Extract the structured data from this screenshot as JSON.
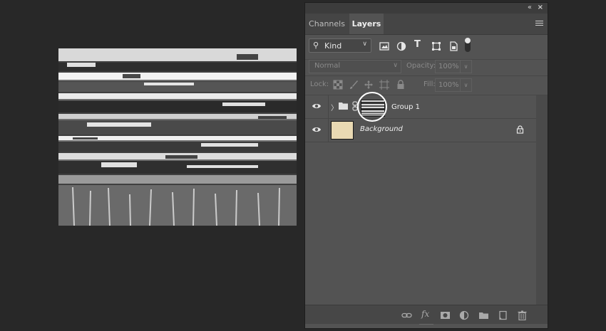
{
  "panel": {
    "tabs": [
      "Channels",
      "Layers"
    ],
    "active_tab": "Layers",
    "collapse_glyph": "«",
    "close_glyph": "×"
  },
  "filter": {
    "kind_label": "Kind",
    "icons": [
      "pixel-filter-icon",
      "adjustment-filter-icon",
      "type-filter-icon",
      "shape-filter-icon",
      "smart-object-filter-icon"
    ]
  },
  "blend": {
    "mode": "Normal",
    "opacity_label": "Opacity:",
    "opacity_value": "100%"
  },
  "lock": {
    "label": "Lock:",
    "fill_label": "Fill:",
    "fill_value": "100%"
  },
  "layers": [
    {
      "name": "Group 1",
      "type": "group",
      "visible": true,
      "thumbnail": "grunge-texture"
    },
    {
      "name": "Background",
      "type": "background",
      "visible": true,
      "locked": true,
      "fill_color": "#e9d9b3"
    }
  ],
  "bottom_icons": [
    "link-layers-icon",
    "fx-icon",
    "add-mask-icon",
    "adjustment-layer-icon",
    "new-group-icon",
    "new-layer-icon",
    "delete-icon"
  ],
  "colors": {
    "workspace": "#282828",
    "panel": "#535353",
    "background_swatch": "#e9d9b3"
  }
}
